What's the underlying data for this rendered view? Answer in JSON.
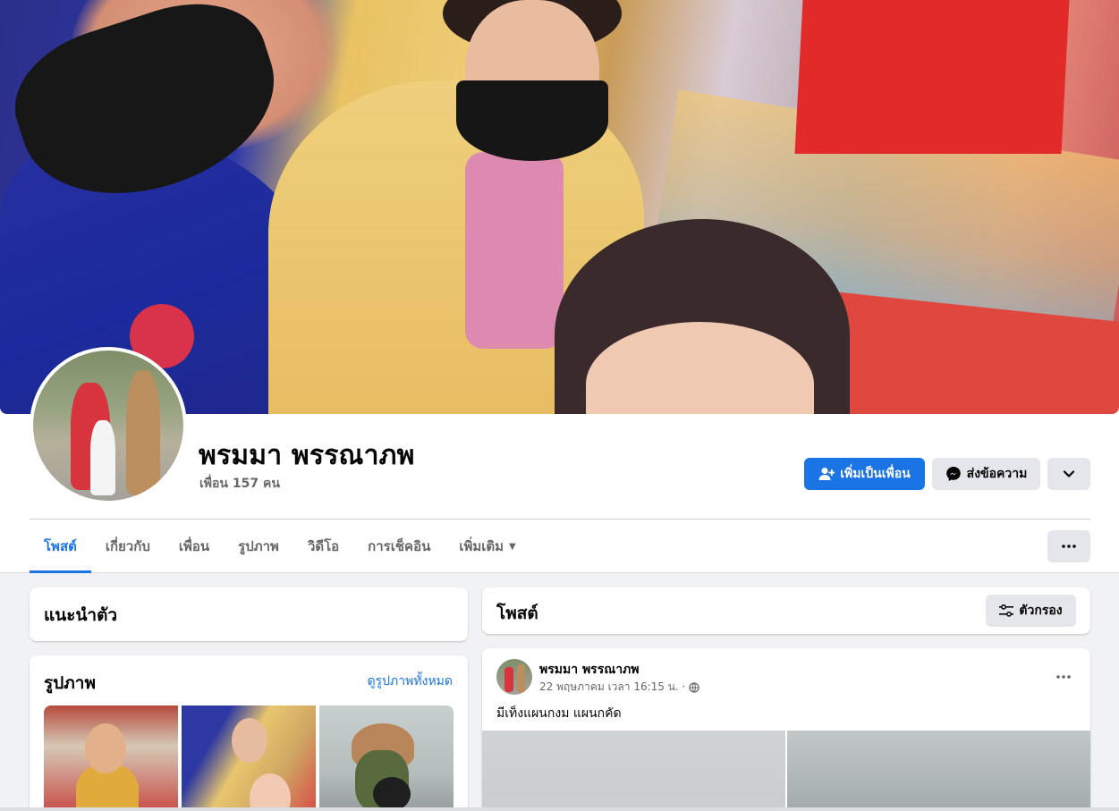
{
  "profile": {
    "name": "พรมมา พรรณาภพ",
    "friends": "เพื่อน 157 คน"
  },
  "actions": {
    "add_friend": "เพิ่มเป็นเพื่อน",
    "message": "ส่งข้อความ"
  },
  "tabs": [
    {
      "label": "โพสต์",
      "active": true
    },
    {
      "label": "เกี่ยวกับ"
    },
    {
      "label": "เพื่อน"
    },
    {
      "label": "รูปภาพ"
    },
    {
      "label": "วิดีโอ"
    },
    {
      "label": "การเช็คอิน"
    },
    {
      "label": "เพิ่มเติม"
    }
  ],
  "intro": {
    "title": "แนะนำตัว"
  },
  "photos": {
    "title": "รูปภาพ",
    "see_all": "ดูรูปภาพทั้งหมด"
  },
  "posts": {
    "title": "โพสต์",
    "filter": "ตัวกรอง",
    "items": [
      {
        "author": "พรมมา พรรณาภพ",
        "timestamp": "22 พฤษภาคม เวลา 16:15 น. ·",
        "text": "มีเท็งแผนกงม แผนกคัด"
      }
    ]
  },
  "colors": {
    "accent": "#1b74e4",
    "background": "#f0f2f5",
    "secondary_button": "#e4e6eb",
    "muted_text": "#65676b"
  },
  "icons": [
    "add-friend-icon",
    "messenger-icon",
    "chevron-down-icon",
    "more-icon",
    "caret-down-icon",
    "filter-icon",
    "globe-icon"
  ]
}
